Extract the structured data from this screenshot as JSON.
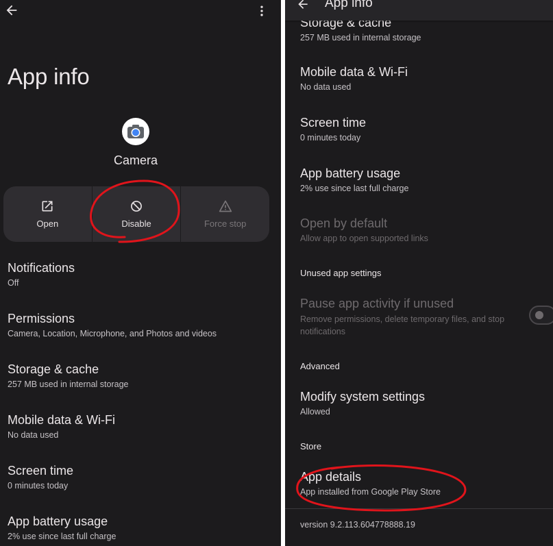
{
  "left": {
    "title": "App info",
    "app_name": "Camera",
    "actions": [
      {
        "label": "Open",
        "icon": "open-external-icon",
        "enabled": true
      },
      {
        "label": "Disable",
        "icon": "disable-icon",
        "enabled": true
      },
      {
        "label": "Force stop",
        "icon": "warning-icon",
        "enabled": false
      }
    ],
    "items": [
      {
        "title": "Notifications",
        "subtitle": "Off"
      },
      {
        "title": "Permissions",
        "subtitle": "Camera, Location, Microphone, and Photos and videos"
      },
      {
        "title": "Storage & cache",
        "subtitle": "257 MB used in internal storage"
      },
      {
        "title": "Mobile data & Wi-Fi",
        "subtitle": "No data used"
      },
      {
        "title": "Screen time",
        "subtitle": "0 minutes today"
      },
      {
        "title": "App battery usage",
        "subtitle": "2% use since last full charge"
      }
    ]
  },
  "right": {
    "title": "App info",
    "items": [
      {
        "title": "Storage & cache",
        "subtitle": "257 MB used in internal storage"
      },
      {
        "title": "Mobile data & Wi-Fi",
        "subtitle": "No data used"
      },
      {
        "title": "Screen time",
        "subtitle": "0 minutes today"
      },
      {
        "title": "App battery usage",
        "subtitle": "2% use since last full charge"
      },
      {
        "title": "Open by default",
        "subtitle": "Allow app to open supported links"
      }
    ],
    "unused_section": "Unused app settings",
    "pause_title": "Pause app activity if unused",
    "pause_subtitle": "Remove permissions, delete temporary files, and stop notifications",
    "pause_toggle_on": false,
    "advanced_section": "Advanced",
    "modify_title": "Modify system settings",
    "modify_subtitle": "Allowed",
    "store_section": "Store",
    "app_details_title": "App details",
    "app_details_subtitle": "App installed from Google Play Store",
    "version": "version 9.2.113.604778888.19"
  },
  "colors": {
    "background": "#1c1b1d",
    "button_group": "#2f2d31",
    "text_primary": "#ebe6e8",
    "text_secondary": "#c6c2c6",
    "text_disabled": "#6e6a6d",
    "annotation_red": "#e0141b"
  }
}
